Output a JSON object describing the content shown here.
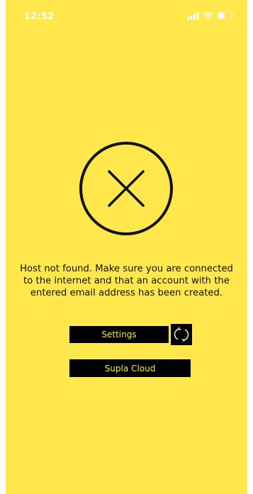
{
  "status_bar": {
    "time": "12:52"
  },
  "error": {
    "icon": "x-circle-icon",
    "message": "Host not found. Make sure you are connected\nto the internet and that an account with the\nentered email address has been created."
  },
  "buttons": {
    "settings_label": "Settings",
    "retry_icon": "refresh-icon",
    "cloud_label": "Supla Cloud"
  },
  "colors": {
    "background": "#FFE74C",
    "button_bg": "#000000",
    "button_text": "#FFE74C",
    "text": "#111111"
  }
}
